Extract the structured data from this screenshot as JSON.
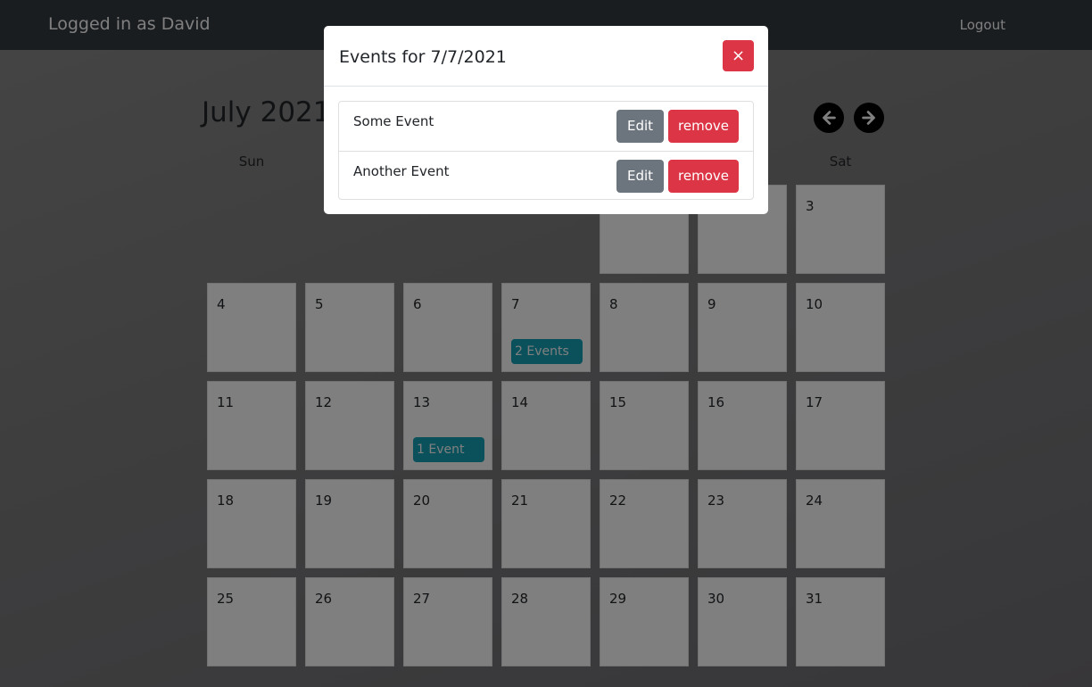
{
  "navbar": {
    "user_label": "Logged in as David",
    "logout_label": "Logout"
  },
  "calendar": {
    "month_label": "July 2021",
    "prev_icon": "arrow-left-circle-icon",
    "next_icon": "arrow-right-circle-icon",
    "weekdays": [
      "Sun",
      "Sat"
    ],
    "days": [
      {
        "num": "3"
      },
      {
        "num": "4"
      },
      {
        "num": "5"
      },
      {
        "num": "6"
      },
      {
        "num": "7",
        "badge": "2 Events"
      },
      {
        "num": "8"
      },
      {
        "num": "9"
      },
      {
        "num": "10"
      },
      {
        "num": "11"
      },
      {
        "num": "12"
      },
      {
        "num": "13",
        "badge": "1 Event"
      },
      {
        "num": "14"
      },
      {
        "num": "15"
      },
      {
        "num": "16"
      },
      {
        "num": "17"
      },
      {
        "num": "18"
      },
      {
        "num": "19"
      },
      {
        "num": "20"
      },
      {
        "num": "21"
      },
      {
        "num": "22"
      },
      {
        "num": "23"
      },
      {
        "num": "24"
      },
      {
        "num": "25"
      },
      {
        "num": "26"
      },
      {
        "num": "27"
      },
      {
        "num": "28"
      },
      {
        "num": "29"
      },
      {
        "num": "30"
      },
      {
        "num": "31"
      }
    ]
  },
  "modal": {
    "title": "Events for 7/7/2021",
    "close_label": "×",
    "events": [
      {
        "name": "Some Event",
        "edit_label": "Edit",
        "remove_label": "remove"
      },
      {
        "name": "Another Event",
        "edit_label": "Edit",
        "remove_label": "remove"
      }
    ]
  },
  "colors": {
    "navbar": "#343a40",
    "badge": "#17a2b8",
    "danger": "#dc3545",
    "secondary": "#6c757d"
  }
}
